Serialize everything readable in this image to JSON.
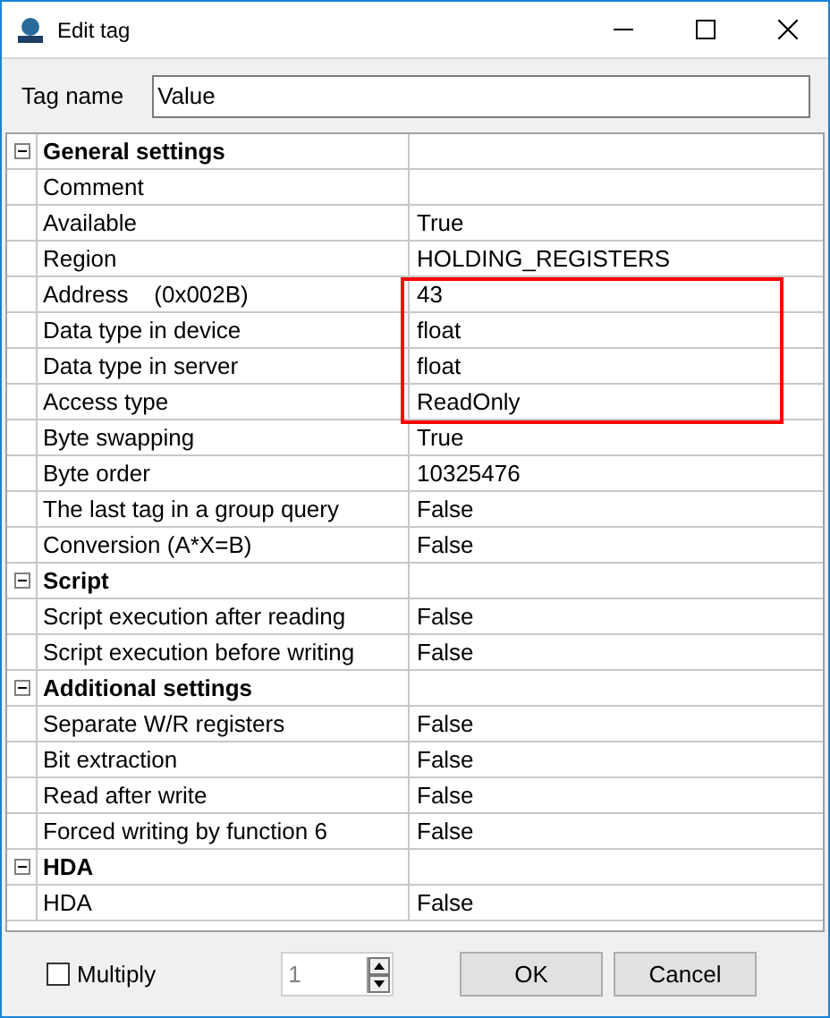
{
  "window": {
    "title": "Edit tag"
  },
  "tag_name": {
    "label": "Tag name",
    "value": "Value"
  },
  "groups": [
    {
      "title": "General settings",
      "expanded": true,
      "children": [
        {
          "name": "Comment"
        },
        {
          "name": "Available",
          "value": "True"
        },
        {
          "name": "Region",
          "value": "HOLDING_REGISTERS"
        },
        {
          "name": "Address    (0x002B)",
          "value": "43"
        },
        {
          "name": "Data type in device",
          "value": "float"
        },
        {
          "name": "Data type in server",
          "value": "float"
        },
        {
          "name": "Access type",
          "value": "ReadOnly"
        },
        {
          "name": "Byte swapping",
          "value": "True"
        },
        {
          "name": "Byte order",
          "value": "10325476"
        },
        {
          "name": "The last tag in a group query",
          "value": "False"
        },
        {
          "name": "Conversion (A*X=B)",
          "value": "False"
        }
      ]
    },
    {
      "title": "Script",
      "expanded": true,
      "children": [
        {
          "name": "Script execution after reading",
          "value": "False"
        },
        {
          "name": "Script execution before writing",
          "value": "False"
        }
      ]
    },
    {
      "title": "Additional settings",
      "expanded": true,
      "children": [
        {
          "name": "Separate W/R registers",
          "value": "False"
        },
        {
          "name": "Bit extraction",
          "value": "False"
        },
        {
          "name": "Read after write",
          "value": "False"
        },
        {
          "name": "Forced writing by function 6",
          "value": "False"
        }
      ]
    },
    {
      "title": "HDA",
      "expanded": true,
      "children": [
        {
          "name": "HDA",
          "value": "False"
        }
      ]
    }
  ],
  "multiply": {
    "label": "Multiply",
    "checked": false,
    "count": "1",
    "disabled": true
  },
  "buttons": [
    "OK",
    "Cancel"
  ]
}
